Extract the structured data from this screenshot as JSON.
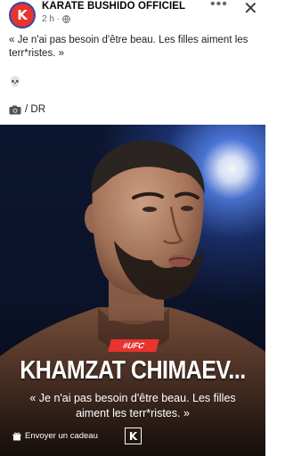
{
  "post": {
    "page_name": "KARATE BUSHIDO OFFICIEL",
    "time_ago": "2 h ·",
    "more_icon": "more-horizontal-icon",
    "close_icon": "close-icon",
    "caption": "« Je n'ai pas besoin d'être beau. Les filles aiment les terr*ristes. »",
    "emoji": "💀",
    "credit_text": "/ DR",
    "avatar_letter": "K"
  },
  "image": {
    "tag": "#UFC",
    "headline": "KHAMZAT CHIMAEV...",
    "quote": "« Je n'ai pas besoin d'être beau. Les filles aiment les terr*ristes. »",
    "gift_label": "Envoyer un cadeau",
    "logo_letter": "K"
  },
  "colors": {
    "brand_red": "#e8332e",
    "brand_blue": "#2b4aa8",
    "stage_blue": "#1a2f6b"
  }
}
